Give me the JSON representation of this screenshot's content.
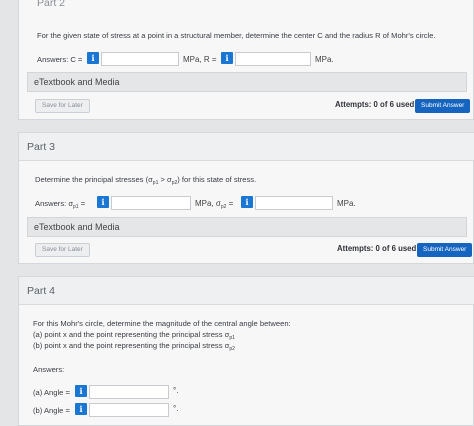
{
  "part2": {
    "title": "Part 2",
    "question": "For the given state of stress at a point in a structural member, determine the center C and the radius R of Mohr's circle.",
    "answers_label": "Answers: C =",
    "unit_mid": "MPa, R =",
    "unit_end": "MPa.",
    "media": "eTextbook and Media",
    "save": "Save for Later",
    "attempts": "Attempts: 0 of 6 used",
    "submit": "Submit Answer"
  },
  "part3": {
    "title": "Part 3",
    "q_pre": "Determine the principal stresses (",
    "sigma_p1": "σ",
    "sub_p1": "p1",
    "gt": " > ",
    "sigma_p2": "σ",
    "sub_p2": "p2",
    "q_post": ") for this state of stress.",
    "answers_label": "Answers: σ",
    "ans_sub1": "p1",
    "eq": " =",
    "unit_mid": "MPa, σ",
    "ans_sub2": "p2",
    "eq2": " =",
    "unit_end": "MPa.",
    "media": "eTextbook and Media",
    "save": "Save for Later",
    "attempts": "Attempts: 0 of 6 used",
    "submit": "Submit Answer"
  },
  "part4": {
    "title": "Part 4",
    "line1": "For this Mohr's circle, determine the magnitude of the central angle between:",
    "line2a": "(a) point x and the point representing the principal stress σ",
    "line2sub": "p1",
    "line3a": "(b) point x and the point representing the principal stress σ",
    "line3sub": "p2",
    "answers": "Answers:",
    "angle_a": "(a) Angle =",
    "angle_b": "(b) Angle =",
    "deg": "°."
  },
  "icons": {
    "info": "i"
  },
  "colors": {
    "info_blue": "#1976d2",
    "submit_blue": "#1565c0"
  }
}
